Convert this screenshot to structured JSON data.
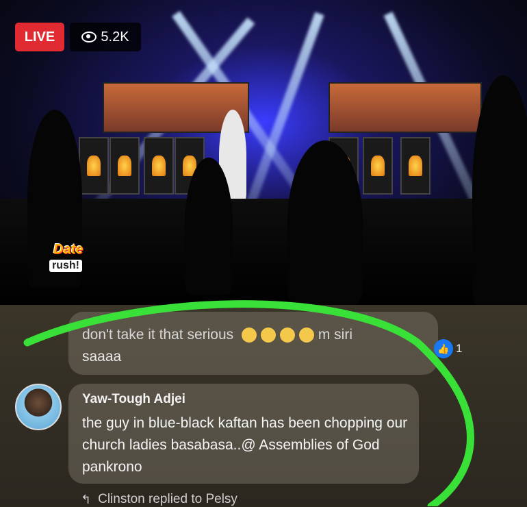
{
  "video": {
    "live_label": "LIVE",
    "viewer_count": "5.2K",
    "logo_top": "Date",
    "logo_bottom": "rush!"
  },
  "comments": [
    {
      "text_line1": "don't take it that serious",
      "text_line1_suffix": "m",
      "text_line1_end": "siri",
      "text_line2": "saaaa",
      "like_count": "1"
    },
    {
      "author": "Yaw-Tough Adjei",
      "text": "the guy in blue-black kaftan has been chopping our church ladies basabasa..@ Assemblies of God pankrono"
    }
  ],
  "reply_indicator": "Clinston replied to Pelsy",
  "colors": {
    "live_red": "#e02b32",
    "like_blue": "#1877f2",
    "annotation_green": "#38e038"
  },
  "icons": [
    "eye-icon",
    "thumbs-up-icon",
    "reply-arrow-icon"
  ]
}
